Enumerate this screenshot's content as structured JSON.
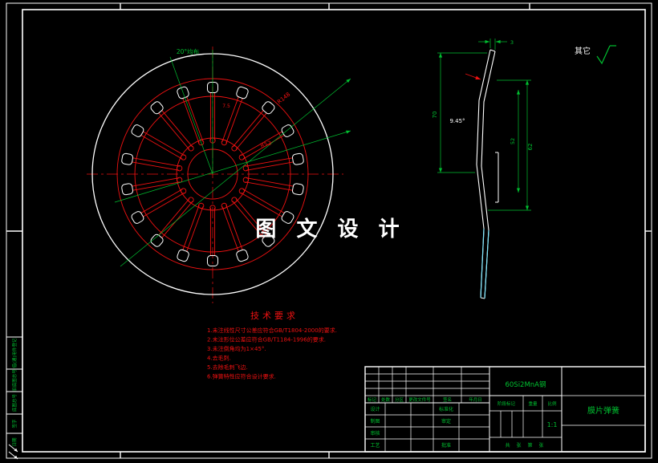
{
  "colors": {
    "background": "#000000",
    "outline_white": "#ffffff",
    "geometry_red": "#ee1111",
    "dimension_green": "#00c030",
    "highlight_cyan": "#7fe8ff"
  },
  "watermark": "图 文 设 计",
  "corner_note": {
    "label": "其它",
    "symbol": "surface-roughness-check"
  },
  "front_view": {
    "dim_angle": "20°均布",
    "dim_radius_outer": "R148",
    "dim_radius_inner": "R52",
    "dim_width": "7.5"
  },
  "side_view": {
    "dim_height": "70",
    "dim_outer": "62",
    "dim_inner": "52",
    "dim_thickness": "3",
    "dim_cone_angle": "9.45°"
  },
  "tech_requirements": {
    "title": "技术要求",
    "items": [
      "1.未注线性尺寸公差应符合GB/T1804-2000的要求.",
      "2.未注形位公差应符合GB/T1184-1996的要求.",
      "3.未注倒角均为1×45°.",
      "4.去毛刺.",
      "5.去除毛刺飞边.",
      "6.弹簧特性应符合设计要求."
    ]
  },
  "title_block": {
    "material": "60Si2MnA钢",
    "part_name": "膜片弹簧",
    "scale_value": "1:1",
    "revision_headers": [
      "标记",
      "处数",
      "分区",
      "更改文件号",
      "签名",
      "年月日"
    ],
    "sign_labels": [
      "设计",
      "制图",
      "审核",
      "工艺"
    ],
    "approve_labels": [
      "标准化",
      "审定",
      "批准"
    ],
    "stage_headers": [
      "阶段标记",
      "重量",
      "比例"
    ],
    "sheet_note": "共 张 第 张"
  },
  "margin_strip": {
    "cells": [
      "借(通)用件登记",
      "旧底图总号",
      "底图总号",
      "签字",
      "日期"
    ]
  }
}
